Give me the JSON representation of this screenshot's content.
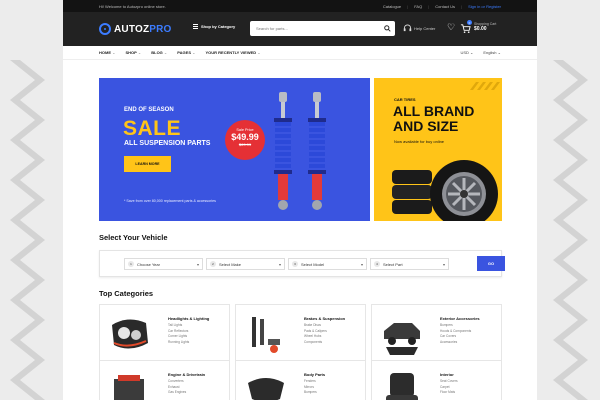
{
  "topbar": {
    "welcome": "Hi! Welcome to Autozpro online store.",
    "links": [
      "Catalogue",
      "FAQ",
      "Contact Us"
    ],
    "signin": "Sign in or Register"
  },
  "header": {
    "logo_main": "AUTOZ",
    "logo_accent": "PRO",
    "category_button": "Shop by Category",
    "search_placeholder": "Search for parts...",
    "help_label": "Help Center",
    "cart_label": "Shopping Cart",
    "cart_amount": "$0.00",
    "cart_count": "0"
  },
  "nav": {
    "items": [
      {
        "label": "HOME"
      },
      {
        "label": "SHOP"
      },
      {
        "label": "BLOG"
      },
      {
        "label": "PAGES"
      },
      {
        "label": "YOUR RECENTLY VIEWED"
      }
    ],
    "currency": "USD",
    "language": "English"
  },
  "hero": {
    "kicker": "END OF SEASON",
    "title": "SALE",
    "subtitle": "ALL SUSPENSION PARTS",
    "button": "LEARN MORE",
    "note": "* Save from over 80,000 replacement parts & accessories",
    "badge_label": "Sale Price",
    "badge_price": "$49.99",
    "badge_old_price": "$69.99"
  },
  "side_banner": {
    "kicker": "CAR TIRES",
    "title": "ALL BRAND AND SIZE",
    "subtitle": "Now available for buy online"
  },
  "vehicle": {
    "title": "Select Your Vehicle",
    "selects": [
      {
        "num": "1",
        "label": "Choose Year"
      },
      {
        "num": "2",
        "label": "Select Make"
      },
      {
        "num": "3",
        "label": "Select Model"
      },
      {
        "num": "4",
        "label": "Select Part"
      }
    ],
    "go_button": "GO"
  },
  "categories": {
    "title": "Top Categories",
    "items": [
      {
        "title": "Headlights & Lighting",
        "subs": [
          "Tail Lights",
          "Car Reflectors",
          "Corner Lights",
          "Running Lights"
        ],
        "icon": "headlight-icon"
      },
      {
        "title": "Brakes & Suspension",
        "subs": [
          "Brake Discs",
          "Pads & Calipers",
          "Wheel Hubs",
          "Components"
        ],
        "icon": "brake-suspension-icon"
      },
      {
        "title": "Exterior Accessories",
        "subs": [
          "Bumpers",
          "Hoods & Components",
          "Car Covers",
          "Accessories"
        ],
        "icon": "truck-accessory-icon"
      },
      {
        "title": "Engine & Drivetrain",
        "subs": [
          "Converters",
          "Exhaust",
          "Gas Engines"
        ],
        "icon": "engine-icon"
      },
      {
        "title": "Body Parts",
        "subs": [
          "Fenders",
          "Mirrors",
          "Bumpers"
        ],
        "icon": "body-part-icon"
      },
      {
        "title": "Interior",
        "subs": [
          "Seat Covers",
          "Carpet",
          "Floor Mats"
        ],
        "icon": "seat-icon"
      }
    ]
  },
  "colors": {
    "primary": "#3a54e0",
    "accent": "#ffc418",
    "dark": "#222222",
    "sale_red": "#e53035"
  }
}
